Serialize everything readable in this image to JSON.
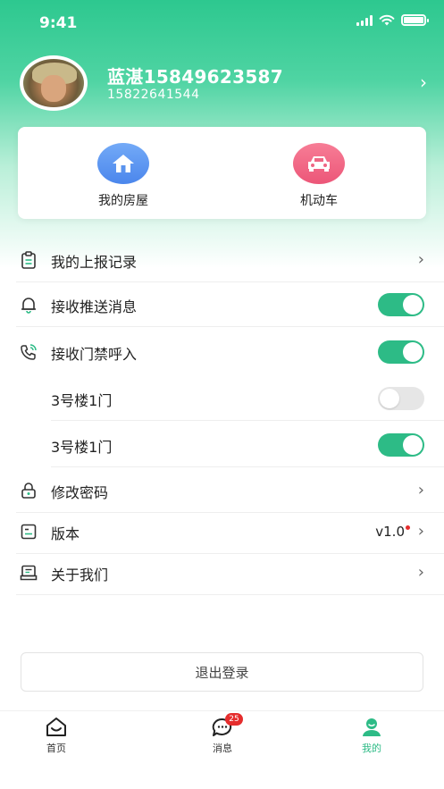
{
  "status_bar": {
    "time": "9:41"
  },
  "profile": {
    "name": "蓝湛15849623587",
    "phone": "15822641544"
  },
  "quick_actions": [
    {
      "label": "我的房屋",
      "icon": "house-icon",
      "color": "#4b86ec"
    },
    {
      "label": "机动车",
      "icon": "car-icon",
      "color": "#ec5678"
    }
  ],
  "menu": {
    "report_records": "我的上报记录",
    "push_messages": {
      "label": "接收推送消息",
      "enabled": true
    },
    "door_calls": {
      "label": "接收门禁呼入",
      "enabled": true
    },
    "door_1": {
      "label": "3号楼1门",
      "enabled": false
    },
    "door_2": {
      "label": "3号楼1门",
      "enabled": true
    },
    "change_password": "修改密码",
    "version": {
      "label": "版本",
      "value": "v1.0",
      "has_update_dot": true
    },
    "about": "关于我们"
  },
  "logout_label": "退出登录",
  "tabbar": {
    "home": "首页",
    "messages": "消息",
    "messages_badge": "25",
    "mine": "我的",
    "active": "mine"
  },
  "colors": {
    "brand_green": "#2dbb86",
    "badge_red": "#e52d2d"
  }
}
